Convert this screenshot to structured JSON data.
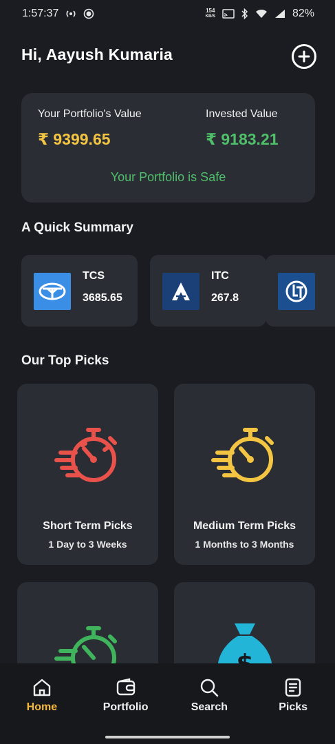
{
  "status_bar": {
    "time": "1:57:37",
    "net_speed_value": "154",
    "net_speed_unit": "KB/S",
    "battery": "82%"
  },
  "header": {
    "greeting": "Hi, Aayush Kumaria",
    "add_icon": "plus-circle-icon"
  },
  "portfolio": {
    "value_label": "Your Portfolio's Value",
    "value": "₹ 9399.65",
    "invested_label": "Invested Value",
    "invested": "₹ 9183.21",
    "status": "Your Portfolio is Safe",
    "colors": {
      "value": "#f4c542",
      "invested": "#4fbf6a",
      "status": "#4fbf6a"
    }
  },
  "quick_summary": {
    "title": "A Quick Summary",
    "stocks": [
      {
        "name": "TCS",
        "price": "3685.65",
        "logo": "tcs-logo",
        "color": "#3a8ee6"
      },
      {
        "name": "ITC",
        "price": "267.8",
        "logo": "itc-logo",
        "color": "#1b3f77"
      },
      {
        "name": "",
        "price": "",
        "logo": "lt-logo",
        "color": "#1b4f8f"
      }
    ]
  },
  "top_picks": {
    "title": "Our Top Picks",
    "cards": [
      {
        "title": "Short Term Picks",
        "subtitle": "1 Day to 3 Weeks",
        "icon": "stopwatch-icon",
        "color": "#e8524a"
      },
      {
        "title": "Medium Term Picks",
        "subtitle": "1 Months to 3 Months",
        "icon": "stopwatch-icon",
        "color": "#f4c542"
      },
      {
        "title": "",
        "subtitle": "",
        "icon": "stopwatch-icon",
        "color": "#3fb45c"
      },
      {
        "title": "",
        "subtitle": "",
        "icon": "money-bag-icon",
        "color": "#22b5d8"
      }
    ]
  },
  "nav": {
    "items": [
      {
        "label": "Home",
        "icon": "home-icon",
        "active": true
      },
      {
        "label": "Portfolio",
        "icon": "wallet-icon",
        "active": false
      },
      {
        "label": "Search",
        "icon": "search-icon",
        "active": false
      },
      {
        "label": "Picks",
        "icon": "list-icon",
        "active": false
      }
    ],
    "active_color": "#f4b73e"
  }
}
